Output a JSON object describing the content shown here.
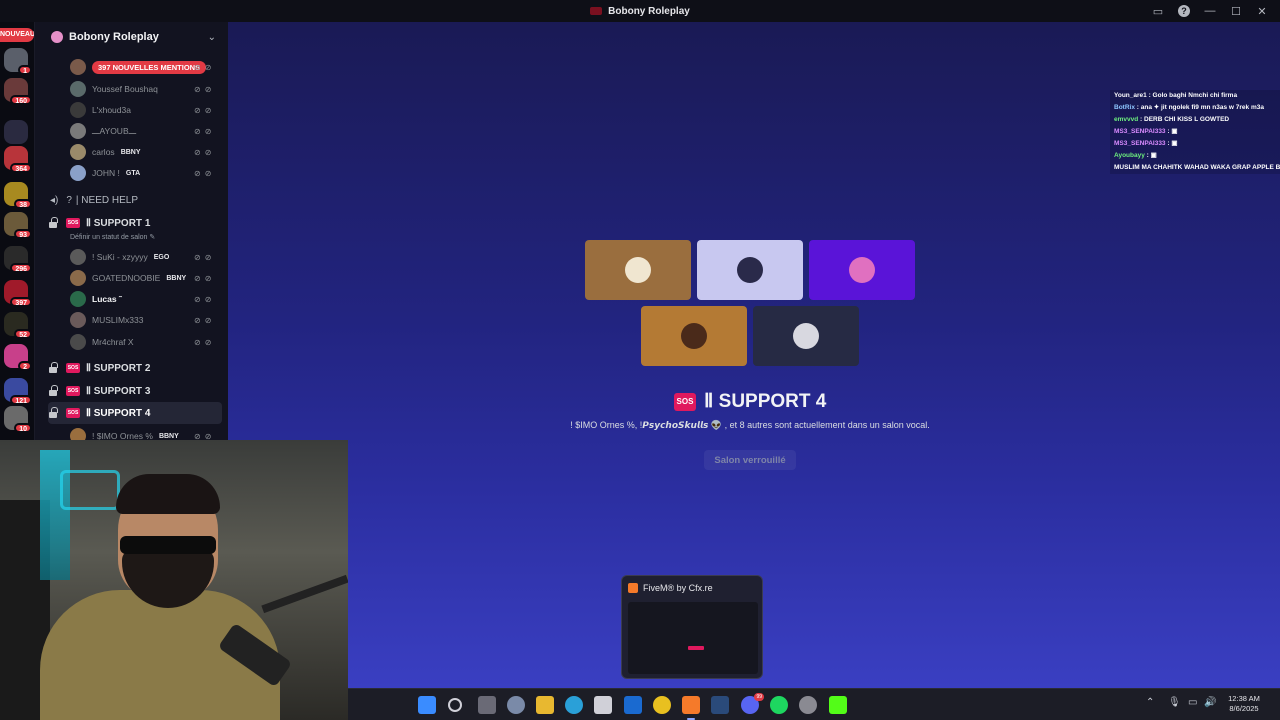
{
  "window": {
    "title": "Bobony Roleplay"
  },
  "rail": {
    "new_label": "NOUVEAU",
    "servers": [
      {
        "badge": "1",
        "color": "#5a5f6a"
      },
      {
        "badge": "160",
        "color": "#6a3a3a"
      },
      {
        "badge": "",
        "color": "#2a2a40"
      },
      {
        "badge": "364",
        "color": "#b8343a"
      },
      {
        "badge": "38",
        "color": "#a88a20"
      },
      {
        "badge": "93",
        "color": "#6b5a3a"
      },
      {
        "badge": "296",
        "color": "#2a2a2a"
      },
      {
        "badge": "397",
        "color": "#a01a2a"
      },
      {
        "badge": "52",
        "color": "#2a2a20"
      },
      {
        "badge": "2",
        "color": "#c8408a"
      },
      {
        "badge": "121",
        "color": "#3a4aa0"
      },
      {
        "badge": "10",
        "color": "#6a6a6a"
      }
    ]
  },
  "server": {
    "name": "Bobony Roleplay"
  },
  "voice_users_top": [
    {
      "name": "",
      "tag": "397 NOUVELLES MENTIONS",
      "pill": true,
      "color": "#7a5a4a"
    },
    {
      "name": "Youssef Boushaq",
      "tag": "",
      "color": "#5a6a6a"
    },
    {
      "name": "L'xhoud3a",
      "tag": "",
      "color": "#3a3a3a"
    },
    {
      "name": "ـــAYOUBـــ",
      "tag": "",
      "color": "#7a7a7a"
    },
    {
      "name": "carlos",
      "tag": "BBNY",
      "color": "#9a8a6a"
    },
    {
      "name": "JOHN !",
      "tag": "GTA",
      "color": "#8aa0c8"
    }
  ],
  "need_help": {
    "label": "| NEED HELP"
  },
  "support1": {
    "label": "SUPPORT 1",
    "status": "Définir un statut de salon",
    "users": [
      {
        "name": "! SuKi - xzyyyy",
        "tag": "EGO",
        "color": "#5a5a5a"
      },
      {
        "name": "GOATEDNOOBIE",
        "tag": "BBNY",
        "color": "#8a6a4a"
      },
      {
        "name": "Lucas ˜",
        "tag": "",
        "color": "#2a6a4a",
        "bright": true
      },
      {
        "name": "MUSLIMx333",
        "tag": "",
        "color": "#6a5a5a"
      },
      {
        "name": "Mr4chraf X",
        "tag": "",
        "color": "#4a4a4a"
      }
    ]
  },
  "support_channels": [
    {
      "label": "SUPPORT 2"
    },
    {
      "label": "SUPPORT 3"
    },
    {
      "label": "SUPPORT 4"
    }
  ],
  "support4_user": {
    "name": "! $IMO Ornes %",
    "tag": "BBNY"
  },
  "stage": {
    "tiles": [
      {
        "bg": "#9a6e3e",
        "pfp": "#f0e6d0"
      },
      {
        "bg": "#c8c8f0",
        "pfp": "#2a2a4a"
      },
      {
        "bg": "#5a14d8",
        "pfp": "#e070c0"
      },
      {
        "bg": "#b47a34",
        "pfp": "#4a2a1a"
      },
      {
        "bg": "#262a44",
        "pfp": "#d8d8e0"
      }
    ],
    "sos_label": "SOS",
    "channel_title": "SUPPORT 4",
    "subtitle": "! $IMO Ornes %, !𝙋𝙨𝙮𝙘𝙝𝙤𝙎𝙠𝙪𝙡𝙡𝙨 👽 , et 8 autres sont actuellement dans un salon vocal.",
    "locked_button": "Salon verrouillé"
  },
  "chat": [
    {
      "user": "Youn_are1",
      "msg": "Golo baghi Nmchi chi firma",
      "cls": ""
    },
    {
      "user": "BotRix",
      "msg": "ana ✦ jit ngolek fi9 mn n3as w 7rek m3a",
      "cls": "u-blue"
    },
    {
      "user": "emvvvd",
      "msg": "DERB CHI KISS L GOWTED",
      "cls": "u-green"
    },
    {
      "user": "MS3_SENPAI333",
      "msg": "▣",
      "cls": "u-purple"
    },
    {
      "user": "MS3_SENPAI333",
      "msg": "▣",
      "cls": "u-purple"
    },
    {
      "user": "Ayoubayy",
      "msg": "▣",
      "cls": "u-green"
    },
    {
      "user": "",
      "msg": "MUSLIM MA CHAHITK WAHAD WAKA GRAP APPLE BAG",
      "cls": ""
    }
  ],
  "preview": {
    "title": "FiveM® by Cfx.re"
  },
  "taskbar": {
    "time": "12:38 AM",
    "date": "8/6/2025",
    "discord_badge": "99"
  }
}
